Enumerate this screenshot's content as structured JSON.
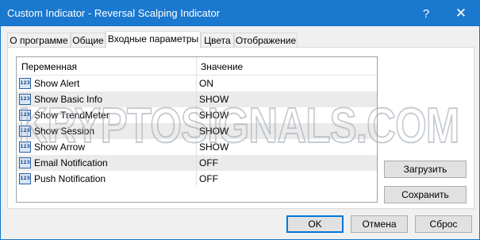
{
  "window": {
    "title": "Custom Indicator - Reversal Scalping Indicator",
    "help_glyph": "?",
    "close_glyph": "✕"
  },
  "tabs": [
    {
      "label": "О программе",
      "active": false
    },
    {
      "label": "Общие",
      "active": false
    },
    {
      "label": "Входные параметры",
      "active": true
    },
    {
      "label": "Цвета",
      "active": false
    },
    {
      "label": "Отображение",
      "active": false
    }
  ],
  "grid": {
    "columns": {
      "variable": "Переменная",
      "value": "Значение"
    },
    "icon_text": "123",
    "icon_name": "numeric-parameter-icon",
    "rows": [
      {
        "name": "Show Alert",
        "value": "ON"
      },
      {
        "name": "Show Basic Info",
        "value": "SHOW"
      },
      {
        "name": "Show TrendMeter",
        "value": "SHOW"
      },
      {
        "name": "Show Session",
        "value": "SHOW"
      },
      {
        "name": "Show Arrow",
        "value": "SHOW"
      },
      {
        "name": "Email Notification",
        "value": "OFF"
      },
      {
        "name": "Push Notification",
        "value": "OFF"
      }
    ]
  },
  "side_buttons": {
    "load": "Загрузить",
    "save": "Сохранить"
  },
  "footer_buttons": {
    "ok": "OK",
    "cancel": "Отмена",
    "reset": "Сброс"
  },
  "watermark": {
    "text": "KRYPTOSIGNALS.COM"
  },
  "colors": {
    "titlebar": "#1a78cf",
    "alt_row": "#ebebeb",
    "default_button_border": "#0078d7"
  }
}
